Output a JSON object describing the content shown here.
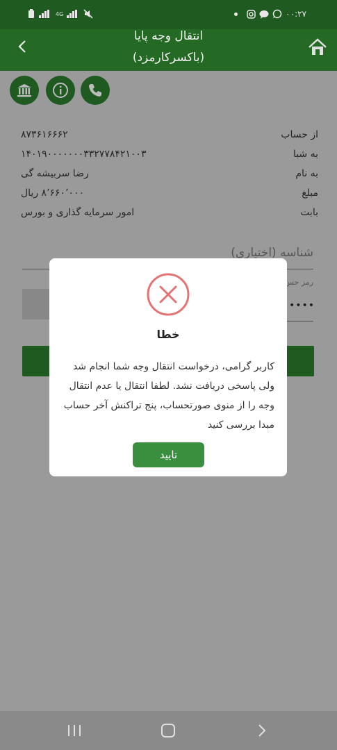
{
  "status_bar": {
    "time": "۰۰:۲۷"
  },
  "app_bar": {
    "title_line1": "انتقال وجه پایا",
    "title_line2": "(باکسرکارمزد)"
  },
  "details": {
    "rows": [
      {
        "label": "از حساب",
        "value": "۸۷۳۶۱۶۶۶۲"
      },
      {
        "label": "به شبا",
        "value": "۱۴۰۱۹۰۰۰۰۰۰۰۳۳۲۷۷۸۴۲۱۰۰۳"
      },
      {
        "label": "به نام",
        "value": "رضا سربیشه گی"
      },
      {
        "label": "مبلغ",
        "value": "۸٬۶۶۰٬۰۰۰ ریال"
      },
      {
        "label": "بابت",
        "value": "امور سرمایه گذاری و بورس"
      }
    ]
  },
  "form": {
    "id_field_label": "شناسه (اختیاری)",
    "password_label": "رمز حس",
    "password_value": "••••••"
  },
  "dialog": {
    "title": "خطا",
    "message": "کاربر گرامی، درخواست انتقال وجه شما انجام شد ولی پاسخی دریافت نشد. لطفا انتقال یا عدم انتقال وجه را از منوی صورتحساب، پنج تراکنش آخر حساب مبدا بررسی کنید",
    "confirm_label": "تایید",
    "error_color": "#e57373",
    "button_color": "#3a8f3e"
  },
  "nav_bar": {
    "items": [
      "recent-apps",
      "home",
      "back"
    ]
  }
}
